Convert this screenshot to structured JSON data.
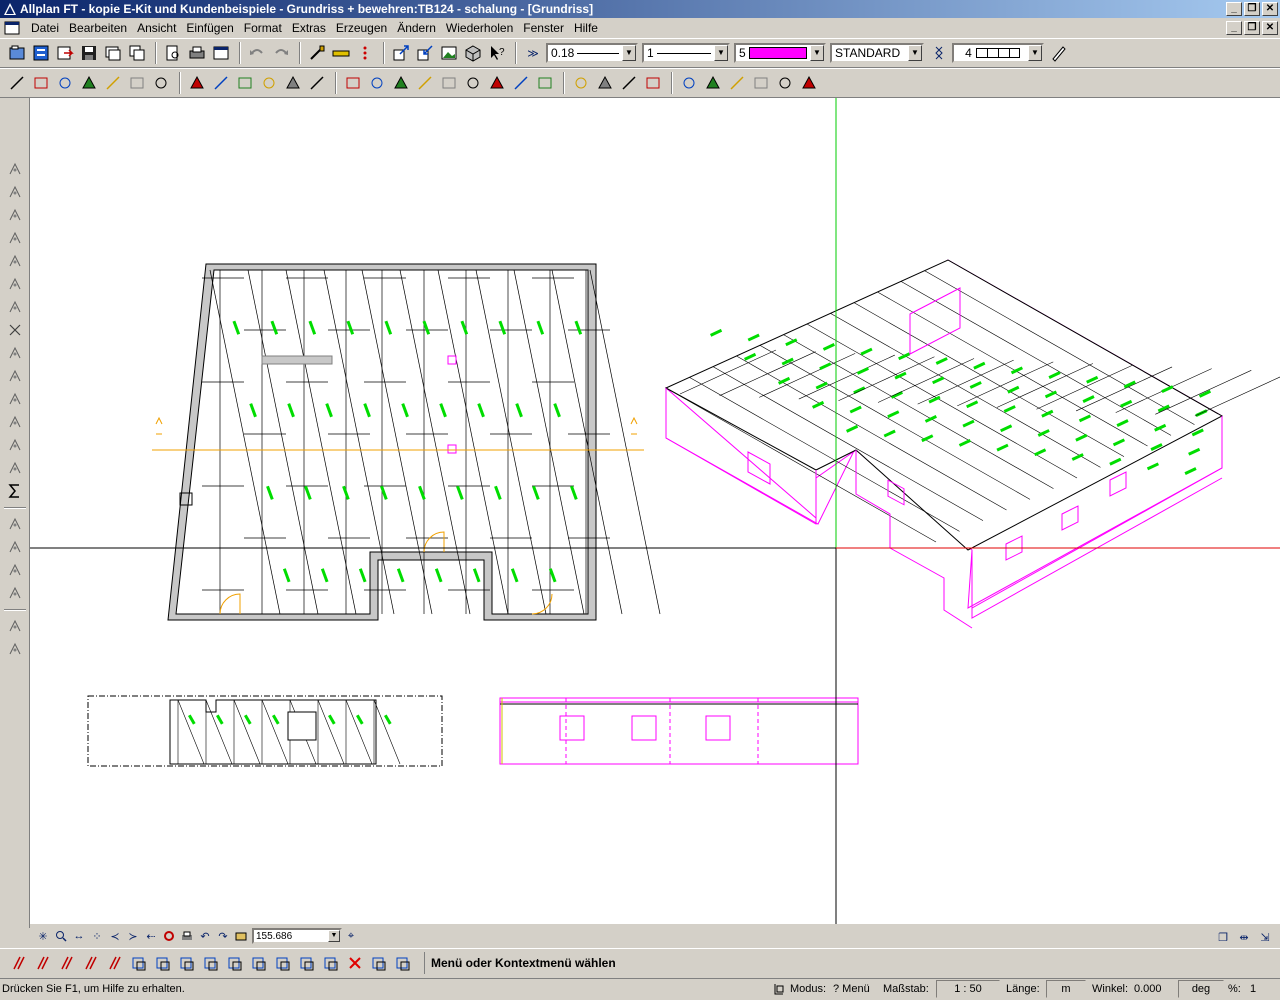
{
  "window": {
    "title": "Allplan FT - kopie E-Kit und Kundenbeispiele - Grundriss + bewehren:TB124 - schalung - [Grundriss]"
  },
  "menu": {
    "items": [
      {
        "label": "Datei"
      },
      {
        "label": "Bearbeiten"
      },
      {
        "label": "Ansicht"
      },
      {
        "label": "Einfügen"
      },
      {
        "label": "Format"
      },
      {
        "label": "Extras"
      },
      {
        "label": "Erzeugen"
      },
      {
        "label": "Ändern"
      },
      {
        "label": "Wiederholen"
      },
      {
        "label": "Fenster"
      },
      {
        "label": "Hilfe"
      }
    ]
  },
  "format_bar": {
    "pen": "0.18",
    "line": "1",
    "color_index": "5",
    "color_hex": "#ff00ff",
    "layer": "STANDARD",
    "pattern": "4"
  },
  "view_bar": {
    "zoom_value": "155.686"
  },
  "prompt": {
    "text": "Menü oder Kontextmenü wählen"
  },
  "status": {
    "help": "Drücken Sie F1, um Hilfe zu erhalten.",
    "mode_label": "Modus:",
    "mode_value": "? Menü",
    "scale_label": "Maßstab:",
    "scale_value": "1 : 50",
    "length_label": "Länge:",
    "length_unit": "m",
    "angle_label": "Winkel:",
    "angle_value": "0.000",
    "angle_unit": "deg",
    "percent_label": "%:",
    "percent_value": "1"
  },
  "colors": {
    "titlebar_start": "#0a246a",
    "titlebar_end": "#a6caf0",
    "chrome": "#d4d0c8",
    "canvas": "#ffffff",
    "magenta": "#ff00ff",
    "rebar_label": "#00dd00",
    "crosshair_green": "#00cc00",
    "crosshair_red": "#e00000",
    "section_orange": "#f0a000"
  },
  "icons": {
    "toolbar1": [
      "open-project-icon",
      "open-file-icon",
      "fileset-icon",
      "save-icon",
      "layer-icon",
      "copy-layer-icon",
      "preview-icon",
      "print-icon",
      "window-icon",
      "undo-icon",
      "redo-icon",
      "brush-icon",
      "measure-icon",
      "dots-icon",
      "export-icon",
      "import-icon",
      "image-icon",
      "cube-icon",
      "help-pointer-icon"
    ],
    "toolbar2": [
      "line-icon",
      "polyline-icon",
      "spline-icon",
      "text-icon",
      "dimension-icon",
      "hatch-icon",
      "fill-icon",
      "pen-icon",
      "line-2-icon",
      "folder-icon",
      "grid-icon",
      "circle-icon",
      "point-icon",
      "wall-icon",
      "column-icon",
      "beam-icon",
      "slab-icon",
      "stair-icon",
      "roof-icon",
      "opening-icon",
      "window-tool-icon",
      "door-icon",
      "bar-icon",
      "mesh-icon",
      "rebar-icon",
      "label-icon",
      "select-icon",
      "zoom-area-icon",
      "pan-icon",
      "refresh-icon",
      "snap-icon",
      "number-one-icon"
    ]
  }
}
